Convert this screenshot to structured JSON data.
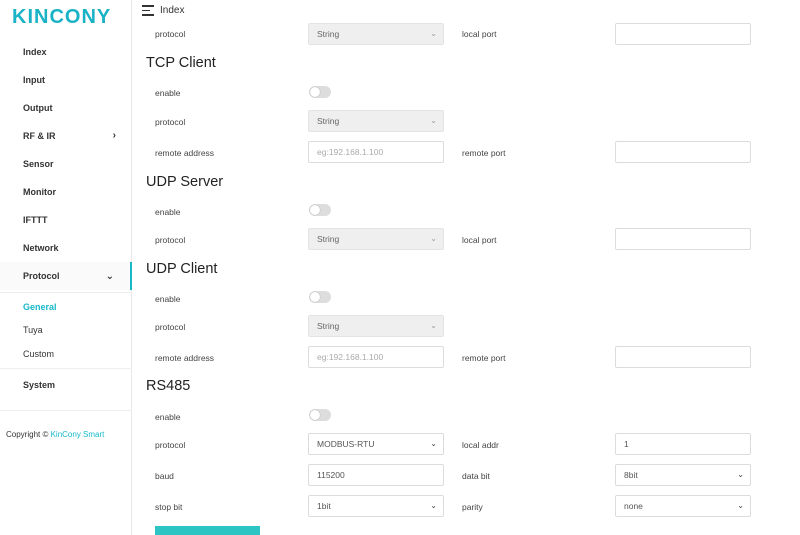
{
  "brand": {
    "logo_text": "KINCONY",
    "color": "#1ab3c6"
  },
  "header": {
    "breadcrumb": "Index"
  },
  "sidebar": {
    "items": [
      {
        "label": "Index"
      },
      {
        "label": "Input"
      },
      {
        "label": "Output"
      },
      {
        "label": "RF & IR"
      },
      {
        "label": "Sensor"
      },
      {
        "label": "Monitor"
      },
      {
        "label": "IFTTT"
      },
      {
        "label": "Network"
      },
      {
        "label": "Protocol"
      }
    ],
    "protocol_sub": [
      {
        "label": "General"
      },
      {
        "label": "Tuya"
      },
      {
        "label": "Custom"
      }
    ],
    "system_label": "System",
    "copyright_prefix": "Copyright ©",
    "copyright_brand": "KinCony Smart"
  },
  "top_partial": {
    "protocol_label": "protocol",
    "protocol_value": "String",
    "local_port_label": "local port",
    "local_port_value": ""
  },
  "tcp_client": {
    "title": "TCP Client",
    "enable_label": "enable",
    "enabled": false,
    "protocol_label": "protocol",
    "protocol_value": "String",
    "remote_address_label": "remote address",
    "remote_address_placeholder": "eg:192.168.1.100",
    "remote_port_label": "remote port",
    "remote_port_value": ""
  },
  "udp_server": {
    "title": "UDP Server",
    "enable_label": "enable",
    "enabled": false,
    "protocol_label": "protocol",
    "protocol_value": "String",
    "local_port_label": "local port",
    "local_port_value": ""
  },
  "udp_client": {
    "title": "UDP Client",
    "enable_label": "enable",
    "enabled": false,
    "protocol_label": "protocol",
    "protocol_value": "String",
    "remote_address_label": "remote address",
    "remote_address_placeholder": "eg:192.168.1.100",
    "remote_port_label": "remote port",
    "remote_port_value": ""
  },
  "rs485": {
    "title": "RS485",
    "enable_label": "enable",
    "enabled": false,
    "protocol_label": "protocol",
    "protocol_value": "MODBUS-RTU",
    "local_addr_label": "local addr",
    "local_addr_value": "1",
    "baud_label": "baud",
    "baud_value": "115200",
    "data_bit_label": "data bit",
    "data_bit_value": "8bit",
    "stop_bit_label": "stop bit",
    "stop_bit_value": "1bit",
    "parity_label": "parity",
    "parity_value": "none"
  },
  "icons": {
    "caret": "chevron-down-icon",
    "menu": "hamburger-menu-icon"
  },
  "accent_color": "#17b9c9",
  "submit_color": "#2cc5c4"
}
